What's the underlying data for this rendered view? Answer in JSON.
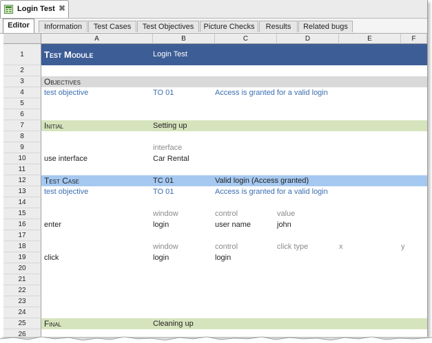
{
  "document_tab": {
    "title": "Login Test",
    "close_glyph": "✖"
  },
  "sub_tabs": [
    {
      "label": "Editor",
      "active": true
    },
    {
      "label": "Information"
    },
    {
      "label": "Test Cases"
    },
    {
      "label": "Test Objectives"
    },
    {
      "label": "Picture Checks"
    },
    {
      "label": "Results"
    },
    {
      "label": "Related bugs"
    }
  ],
  "columns": [
    "A",
    "B",
    "C",
    "D",
    "E",
    "F"
  ],
  "rows": [
    {
      "num": "1",
      "style": "header",
      "cells": {
        "a": "Test Module",
        "b": "Login Test"
      }
    },
    {
      "num": "2"
    },
    {
      "num": "3",
      "style": "gray",
      "cells": {
        "a": "Objectives"
      }
    },
    {
      "num": "4",
      "style": "blue-text",
      "cells": {
        "a": "test objective",
        "b": "TO 01",
        "c": "Access is granted for a valid login"
      }
    },
    {
      "num": "5"
    },
    {
      "num": "6"
    },
    {
      "num": "7",
      "style": "green",
      "cells": {
        "a": "Initial",
        "b": "Setting up"
      }
    },
    {
      "num": "8"
    },
    {
      "num": "9",
      "style": "gray-text",
      "cells": {
        "b": "interface"
      }
    },
    {
      "num": "10",
      "cells": {
        "a": "use interface",
        "b": "Car Rental"
      }
    },
    {
      "num": "11"
    },
    {
      "num": "12",
      "style": "blue",
      "cells": {
        "a": "Test Case",
        "b": "TC 01",
        "c": "Valid login (Access granted)"
      }
    },
    {
      "num": "13",
      "style": "blue-text",
      "cells": {
        "a": "test objective",
        "b": "TO 01",
        "c": "Access is granted for a valid login"
      }
    },
    {
      "num": "14"
    },
    {
      "num": "15",
      "style": "gray-text",
      "cells": {
        "b": "window",
        "c": "control",
        "d": "value"
      }
    },
    {
      "num": "16",
      "cells": {
        "a": "enter",
        "b": "login",
        "c": "user name",
        "d": "john"
      }
    },
    {
      "num": "17"
    },
    {
      "num": "18",
      "style": "gray-text",
      "cells": {
        "b": "window",
        "c": "control",
        "d": "click type",
        "e": "x",
        "f": "y"
      }
    },
    {
      "num": "19",
      "cells": {
        "a": "click",
        "b": "login",
        "c": "login"
      }
    },
    {
      "num": "20"
    },
    {
      "num": "21"
    },
    {
      "num": "22"
    },
    {
      "num": "23"
    },
    {
      "num": "24"
    },
    {
      "num": "25",
      "style": "green",
      "cells": {
        "a": "Final",
        "b": "Cleaning up"
      }
    },
    {
      "num": "26"
    }
  ],
  "colors": {
    "header": "#3d5d96",
    "gray_band": "#d9d9d9",
    "green_band": "#d6e4bd",
    "blue_band": "#a5c8f0",
    "link_text": "#3a6db0"
  }
}
